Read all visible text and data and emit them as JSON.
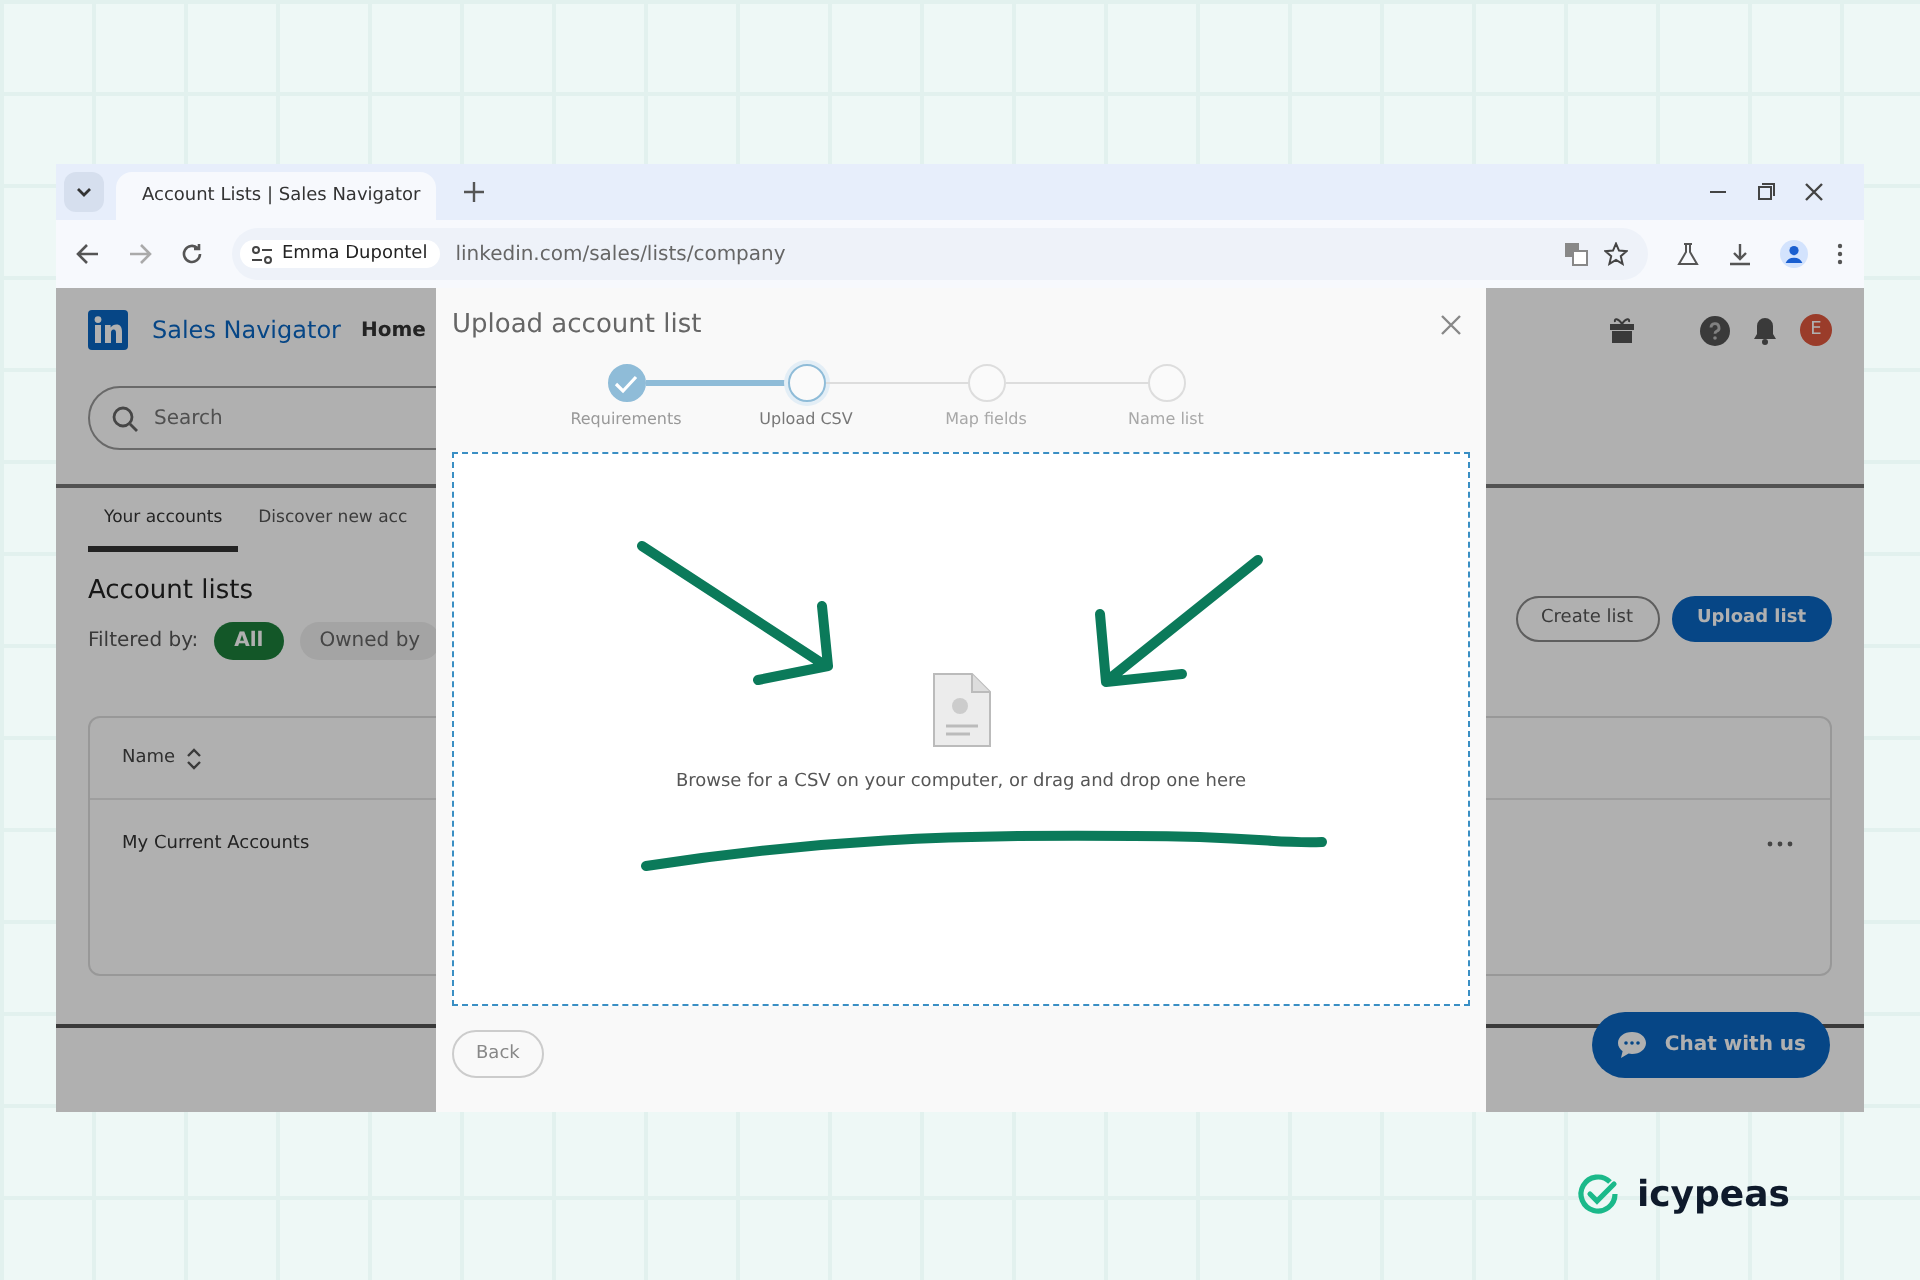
{
  "browser": {
    "tab_title": "Account Lists | Sales Navigator",
    "profile": "Emma Dupontel",
    "url": "linkedin.com/sales/lists/company"
  },
  "app": {
    "brand": "Sales Navigator",
    "nav": [
      "Home"
    ],
    "search": {
      "placeholder": "Search"
    },
    "tabs": [
      {
        "label": "Your accounts",
        "selected": true
      },
      {
        "label": "Discover new acc",
        "selected": false
      }
    ],
    "heading": "Account lists",
    "filter_label": "Filtered by:",
    "filters": [
      {
        "label": "All",
        "selected": true
      },
      {
        "label": "Owned by",
        "selected": false
      }
    ],
    "buttons": [
      "Create list",
      "Upload list"
    ],
    "table": {
      "columns": [
        "Name"
      ],
      "rows": [
        [
          "My Current Accounts"
        ]
      ]
    },
    "avatar": "E",
    "chat": "Chat with us"
  },
  "modal": {
    "title": "Upload account list",
    "steps": [
      {
        "label": "Requirements",
        "completed": true,
        "selected": false
      },
      {
        "label": "Upload CSV",
        "completed": false,
        "selected": true
      },
      {
        "label": "Map fields",
        "completed": false,
        "selected": false
      },
      {
        "label": "Name list",
        "completed": false,
        "selected": false
      }
    ],
    "dropzone_text": "Browse for a CSV on your computer, or drag and drop one here",
    "back": "Back"
  },
  "logo": "icypeas"
}
